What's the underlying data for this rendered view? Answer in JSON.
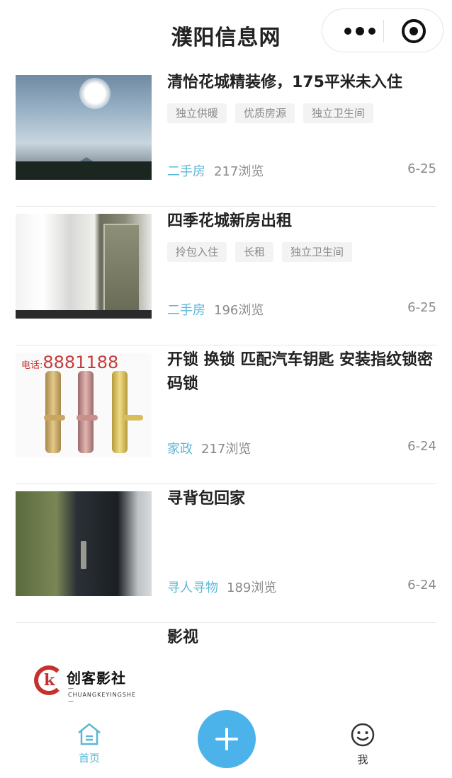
{
  "header": {
    "title": "濮阳信息网",
    "capsule_more_icon": "more-dots-icon",
    "capsule_close_icon": "target-circle-icon"
  },
  "colors": {
    "accent": "#4cb3ea",
    "category": "#5bb7d6",
    "muted": "#8a8a8a"
  },
  "posts": [
    {
      "title": "清怡花城精装修，175平米未入住",
      "tags": [
        "独立供暖",
        "优质房源",
        "独立卫生间"
      ],
      "category": "二手房",
      "views": "217浏览",
      "date": "6-25"
    },
    {
      "title": "四季花城新房出租",
      "tags": [
        "拎包入住",
        "长租",
        "独立卫生间"
      ],
      "category": "二手房",
      "views": "196浏览",
      "date": "6-25"
    },
    {
      "title": "开锁 换锁 匹配汽车钥匙 安装指纹锁密码锁",
      "tags": [],
      "category": "家政",
      "views": "217浏览",
      "date": "6-24",
      "thumb_phone_label": "电话:",
      "thumb_phone_number": "8881188"
    },
    {
      "title": "寻背包回家",
      "tags": [],
      "category": "寻人寻物",
      "views": "189浏览",
      "date": "6-24"
    },
    {
      "title": "影视",
      "tags": [],
      "category": "",
      "views": "",
      "date": "",
      "logo_text": "创客影社",
      "logo_sub": "—CHUANGKEYINGSHE—"
    }
  ],
  "tabbar": {
    "home_label": "首页",
    "home_icon": "home-icon",
    "add_icon": "plus-icon",
    "me_label": "我",
    "me_icon": "smiley-icon"
  }
}
